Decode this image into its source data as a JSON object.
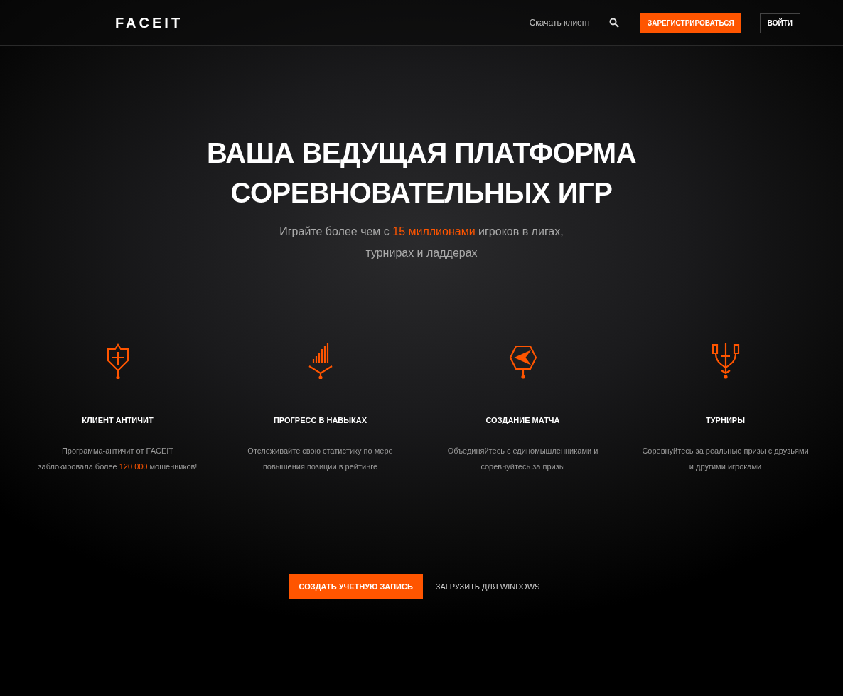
{
  "header": {
    "logo": "FACEIT",
    "nav_link": "Скачать клиент",
    "register_button": "ЗАРЕГИСТРИРОВАТЬСЯ",
    "login_button": "ВОЙТИ"
  },
  "hero": {
    "title": "ВАША ВЕДУЩАЯ ПЛАТФОРМА\nСОРЕВНОВАТЕЛЬНЫХ ИГР",
    "subtitle": "Играйте более чем с **15 миллионами** игроков в лигах,\nтурнирах и ладдерах"
  },
  "features": [
    {
      "kind": "shield",
      "title": "КЛИЕНТ АНТИЧИТ",
      "description": "Программа-античит от FACEIT заблокировала более **120 000** мошенников!"
    },
    {
      "kind": "chart",
      "title": "ПРОГРЕСС В НАВЫКАХ",
      "description": "Отслеживайте свою статистику по мере повышения позиции в рейтинге"
    },
    {
      "kind": "hexagon",
      "title": "СОЗДАНИЕ МАТЧА",
      "description": "Объединяйтесь с единомышленниками и соревнуйтесь за призы"
    },
    {
      "kind": "trophy",
      "title": "ТУРНИРЫ",
      "description": "Соревнуйтесь за реальные призы с друзьями и другими игроками"
    }
  ],
  "cta": {
    "primary_button": "СОЗДАТЬ УЧЕТНУЮ ЗАПИСЬ",
    "secondary_link": "ЗАГРУЗИТЬ ДЛЯ WINDOWS"
  }
}
